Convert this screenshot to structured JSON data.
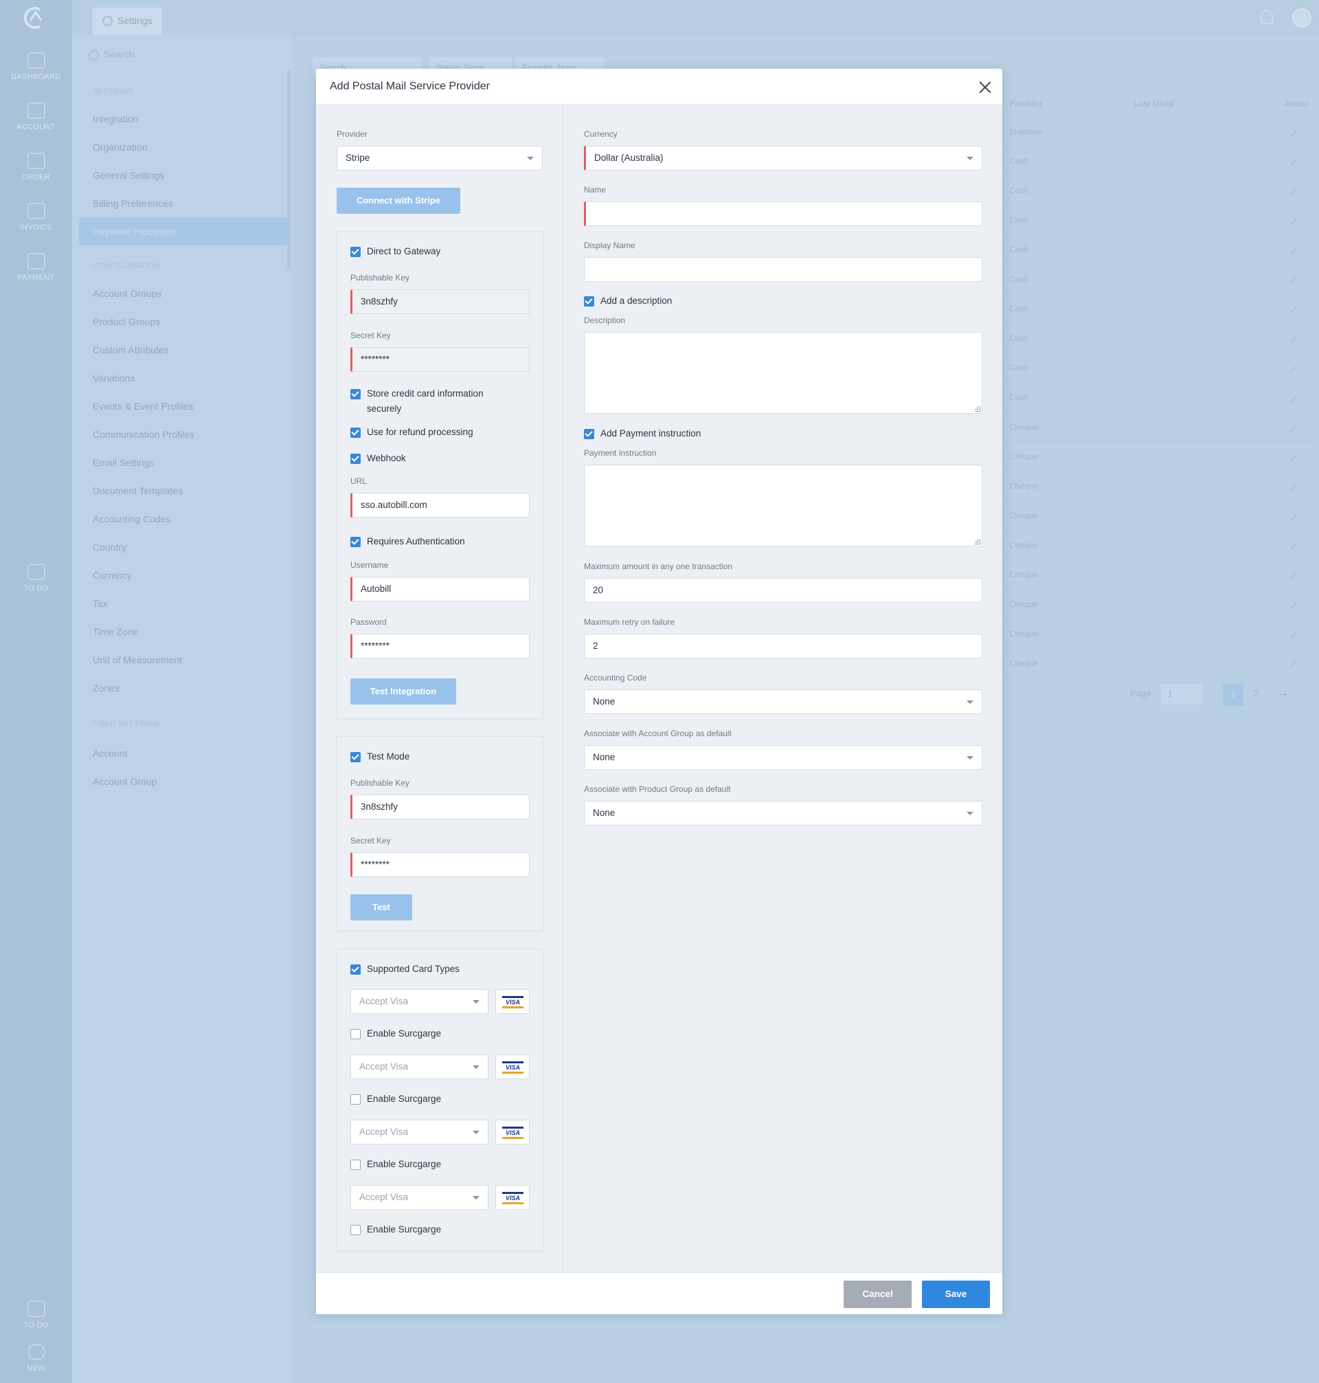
{
  "app": {
    "tab_label": "Settings",
    "nav": [
      "DASHBOARD",
      "ACCOUNT",
      "ORDER",
      "INVOICE",
      "PAYMENT",
      "TO DO",
      "TO DO",
      "NEW"
    ]
  },
  "settings_panel": {
    "search_placeholder": "Search",
    "settings_heading": "SETTINGS",
    "settings_items": [
      "Integration",
      "Organization",
      "General Settings",
      "Billing Preferences"
    ],
    "active_item": "Payment Processor",
    "configuration_heading": "CONFIGURATION",
    "configuration_items": [
      "Account Groups",
      "Product Groups",
      "Custom Attributes",
      "Variations",
      "Events & Event Profiles",
      "Communication Profiles",
      "Email Settings",
      "Document Templates",
      "Accounting Codes",
      "Country",
      "Currency",
      "Tax",
      "Time Zone",
      "Unit of Measurement",
      "Zones"
    ],
    "field_settings_heading": "FIELD SETTINGS",
    "field_settings_items": [
      "Account",
      "Account Group"
    ]
  },
  "background_list": {
    "filters": [
      "Search",
      "Status: None",
      "Provider: None"
    ],
    "columns": [
      "Provider",
      "Last Used",
      "Action"
    ],
    "rows": [
      "Braintree",
      "Cash",
      "Cash",
      "Cash",
      "Cash",
      "Cash",
      "Cash",
      "Cash",
      "Cash",
      "Cash",
      "Cheque",
      "Cheque",
      "Cheque",
      "Cheque",
      "Cheque",
      "Cheque",
      "Cheque",
      "Cheque",
      "Cheque"
    ],
    "pager": {
      "label": "Page",
      "page_select": "1",
      "pages": [
        "1",
        "2"
      ]
    }
  },
  "modal": {
    "title": "Add Postal Mail Service Provider",
    "left": {
      "provider_label": "Provider",
      "provider_value": "Stripe",
      "connect_button": "Connect with Stripe",
      "gateway": {
        "direct_label": "Direct to Gateway",
        "pub_key_label": "Publishable Key",
        "pub_key_value": "3n8szhfy",
        "secret_label": "Secret Key",
        "secret_value": "********",
        "store_label_1": "Store credit card information",
        "store_label_2": "securely",
        "refund_label": "Use for refund processing",
        "webhook_label": "Webhook",
        "url_label": "URL",
        "url_value": "sso.autobill.com",
        "auth_label": "Requires Authentication",
        "username_label": "Username",
        "username_value": "Autobill",
        "password_label": "Password",
        "password_value": "********",
        "test_integration_button": "Test Integration"
      },
      "test_mode": {
        "label": "Test Mode",
        "pub_key_label": "Publishable Key",
        "pub_key_value": "3n8szhfy",
        "secret_label": "Secret Key",
        "secret_value": "********",
        "test_button": "Test"
      },
      "cards": {
        "label": "Supported Card Types",
        "items": [
          {
            "select": "Accept Visa",
            "brand": "VISA",
            "surcharge": "Enable Surcgarge"
          },
          {
            "select": "Accept Visa",
            "brand": "VISA",
            "surcharge": "Enable Surcgarge"
          },
          {
            "select": "Accept Visa",
            "brand": "VISA",
            "surcharge": "Enable Surcgarge"
          },
          {
            "select": "Accept Visa",
            "brand": "VISA",
            "surcharge": "Enable Surcgarge"
          }
        ]
      }
    },
    "right": {
      "currency_label": "Currency",
      "currency_value": "Dollar (Australia)",
      "name_label": "Name",
      "name_value": "",
      "display_name_label": "Display Name",
      "display_name_value": "",
      "add_description_label": "Add a description",
      "description_label": "Description",
      "add_payment_instruction_label": "Add Payment instruction",
      "payment_instruction_label": "Payment instruction",
      "max_amount_label": "Maximum amount in any one transaction",
      "max_amount_value": "20",
      "max_retry_label": "Maximum retry on failure",
      "max_retry_value": "2",
      "accounting_code_label": "Accounting Code",
      "accounting_code_value": "None",
      "account_group_label": "Associate with Account Group as default",
      "account_group_value": "None",
      "product_group_label": "Associate with Product Group as default",
      "product_group_value": "None"
    },
    "footer": {
      "cancel": "Cancel",
      "save": "Save"
    }
  },
  "colors": {
    "primary": "#2f87e0",
    "required_marker": "#e3605a",
    "light_button": "#98c2ec",
    "cancel": "#a5acb5"
  }
}
